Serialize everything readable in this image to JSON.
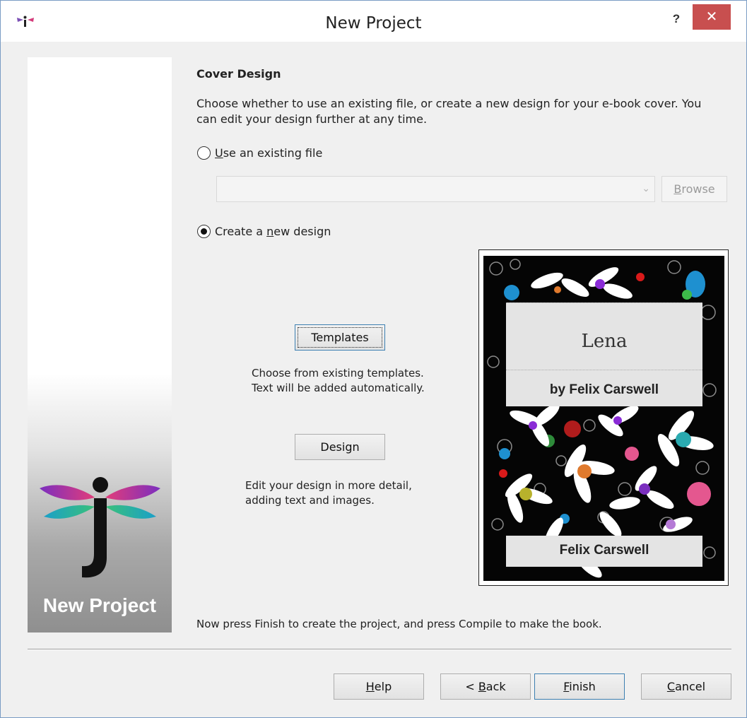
{
  "window": {
    "title": "New Project",
    "help_label": "?",
    "close_label": "✕",
    "app_icon": "dragonfly-j-icon"
  },
  "banner": {
    "title": "New Project",
    "logo": "dragonfly-j-logo"
  },
  "content": {
    "section_title": "Cover Design",
    "description": "Choose whether to use an existing file, or create a new design for your e-book cover. You can edit your design further at any time.",
    "existing": {
      "label_mnemonic": "U",
      "label_rest": "se an existing file",
      "selected": false,
      "path_value": "",
      "browse_mnemonic": "B",
      "browse_rest": "rowse"
    },
    "new_design": {
      "label_pre": "Create a ",
      "label_mnemonic": "n",
      "label_post": "ew design",
      "selected": true
    },
    "templates": {
      "button": "Templates",
      "text": "Choose from existing templates. Text will be added automatically."
    },
    "design": {
      "button": "Design",
      "text": "Edit your design in more detail, adding text and images."
    },
    "preview": {
      "title": "Lena",
      "byline": "by Felix Carswell",
      "author": "Felix Carswell"
    },
    "final_text": "Now press Finish to create the project, and press Compile to make the book."
  },
  "footer": {
    "help": {
      "mnemonic": "H",
      "rest": "elp"
    },
    "back": {
      "pre": "< ",
      "mnemonic": "B",
      "rest": "ack"
    },
    "finish": {
      "mnemonic": "F",
      "rest": "inish"
    },
    "cancel": {
      "mnemonic": "C",
      "rest": "ancel"
    }
  },
  "colors": {
    "close_red": "#c84f4f",
    "focus_blue": "#3c7fb1",
    "panel": "#f0f0f0"
  }
}
